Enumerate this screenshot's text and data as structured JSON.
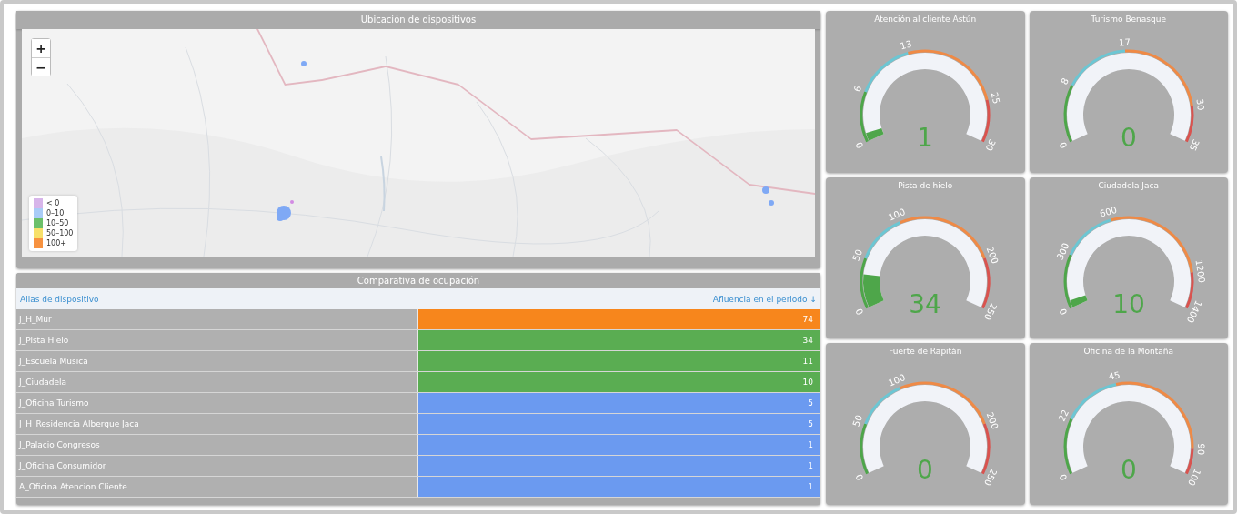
{
  "map": {
    "title": "Ubicación de dispositivos",
    "zoom_in": "+",
    "zoom_out": "−",
    "legend": [
      {
        "label": "< 0",
        "color": "#d7b5ea"
      },
      {
        "label": "0–10",
        "color": "#a9ccf7"
      },
      {
        "label": "10–50",
        "color": "#6cc06a"
      },
      {
        "label": "50–100",
        "color": "#f7e06a"
      },
      {
        "label": "100+",
        "color": "#f79240"
      }
    ]
  },
  "table": {
    "title": "Comparativa de ocupación",
    "columns": [
      "Alias de dispositivo",
      "Afluencia en el periodo ↓"
    ],
    "rows": [
      {
        "alias": "J_H_Mur",
        "value": "74",
        "color": "#f7861c"
      },
      {
        "alias": "J_Pista Hielo",
        "value": "34",
        "color": "#5aad52"
      },
      {
        "alias": "J_Escuela Musica",
        "value": "11",
        "color": "#5aad52"
      },
      {
        "alias": "J_Ciudadela",
        "value": "10",
        "color": "#5aad52"
      },
      {
        "alias": "J_Oficina Turismo",
        "value": "5",
        "color": "#6b9af0"
      },
      {
        "alias": "J_H_Residencia Albergue Jaca",
        "value": "5",
        "color": "#6b9af0"
      },
      {
        "alias": "J_Palacio Congresos",
        "value": "1",
        "color": "#6b9af0"
      },
      {
        "alias": "J_Oficina Consumidor",
        "value": "1",
        "color": "#6b9af0"
      },
      {
        "alias": "A_Oficina Atencion Cliente",
        "value": "1",
        "color": "#6b9af0"
      }
    ]
  },
  "gauges": [
    {
      "title": "Atención al cliente Astún",
      "ticks": [
        "0",
        "6",
        "13",
        "25",
        "30"
      ],
      "value": "1"
    },
    {
      "title": "Turismo Benasque",
      "ticks": [
        "0",
        "8",
        "17",
        "30",
        "35"
      ],
      "value": "0"
    },
    {
      "title": "Pista de hielo",
      "ticks": [
        "0",
        "50",
        "100",
        "200",
        "250"
      ],
      "value": "34"
    },
    {
      "title": "Ciudadela Jaca",
      "ticks": [
        "0",
        "300",
        "600",
        "1200",
        "1400"
      ],
      "value": "10"
    },
    {
      "title": "Fuerte de Rapitán",
      "ticks": [
        "0",
        "50",
        "100",
        "200",
        "250"
      ],
      "value": "0"
    },
    {
      "title": "Oficina de la Montaña",
      "ticks": [
        "0",
        "22",
        "45",
        "90",
        "100"
      ],
      "value": "0"
    }
  ]
}
